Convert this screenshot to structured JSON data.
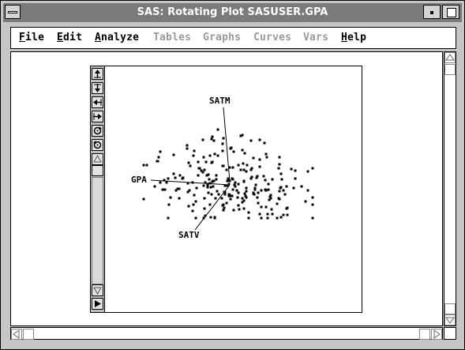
{
  "window": {
    "title": "SAS: Rotating Plot SASUSER.GPA"
  },
  "menubar": {
    "items": [
      {
        "label": "File",
        "enabled": true
      },
      {
        "label": "Edit",
        "enabled": true
      },
      {
        "label": "Analyze",
        "enabled": true
      },
      {
        "label": "Tables",
        "enabled": false
      },
      {
        "label": "Graphs",
        "enabled": false
      },
      {
        "label": "Curves",
        "enabled": false
      },
      {
        "label": "Vars",
        "enabled": false
      },
      {
        "label": "Help",
        "enabled": true
      }
    ]
  },
  "tools": [
    {
      "icon": "rotate-up-icon"
    },
    {
      "icon": "rotate-down-icon"
    },
    {
      "icon": "rotate-left-icon"
    },
    {
      "icon": "rotate-right-icon"
    },
    {
      "icon": "rotate-clockwise-icon"
    },
    {
      "icon": "rotate-counterclockwise-icon"
    }
  ],
  "plot": {
    "axes": {
      "satm": "SATM",
      "gpa": "GPA",
      "satv": "SATV"
    }
  },
  "colors": {
    "titlebar": "#7a7a7a",
    "frame": "#c6c6c6",
    "disabled_text": "#9a9a9a"
  }
}
